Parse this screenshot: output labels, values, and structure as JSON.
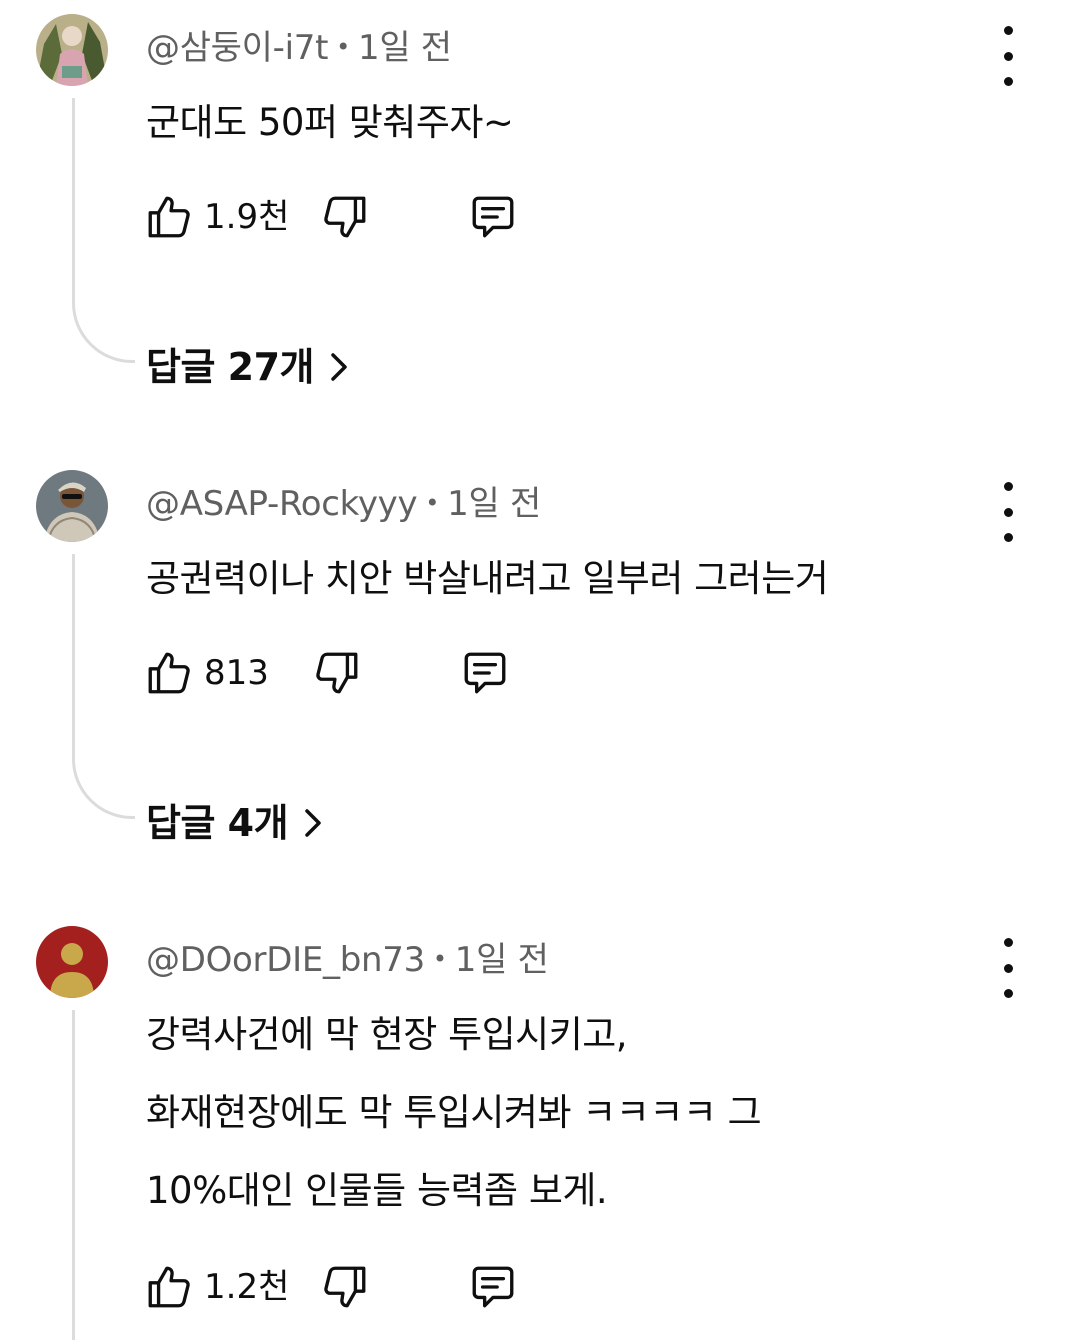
{
  "comments": [
    {
      "author": "@삼둥이-i7t",
      "time": "1일 전",
      "lines": [
        "군대도 50퍼 맞춰주자~"
      ],
      "likes": "1.9천",
      "replies_label": "답글 27개",
      "avatar_icon": "avatar-image"
    },
    {
      "author": "@ASAP-Rockyyy",
      "time": "1일 전",
      "lines": [
        "공권력이나 치안 박살내려고 일부러 그러는거"
      ],
      "likes": "813",
      "replies_label": "답글 4개",
      "avatar_icon": "avatar-image"
    },
    {
      "author": "@DOorDIE_bn73",
      "time": "1일 전",
      "lines": [
        "강력사건에 막 현장 투입시키고,",
        "화재현장에도 막 투입시켜봐 ㅋㅋㅋㅋ 그",
        "10%대인 인물들 능력좀 보게."
      ],
      "likes": "1.2천",
      "avatar_icon": "default-person-avatar",
      "avatar_color": "#a3201e",
      "avatar_person_color": "#c9a84c"
    }
  ],
  "icons": {
    "like": "thumbs-up-icon",
    "dislike": "thumbs-down-icon",
    "reply": "comment-icon",
    "more": "more-vertical-icon",
    "expand": "chevron-right-icon"
  }
}
